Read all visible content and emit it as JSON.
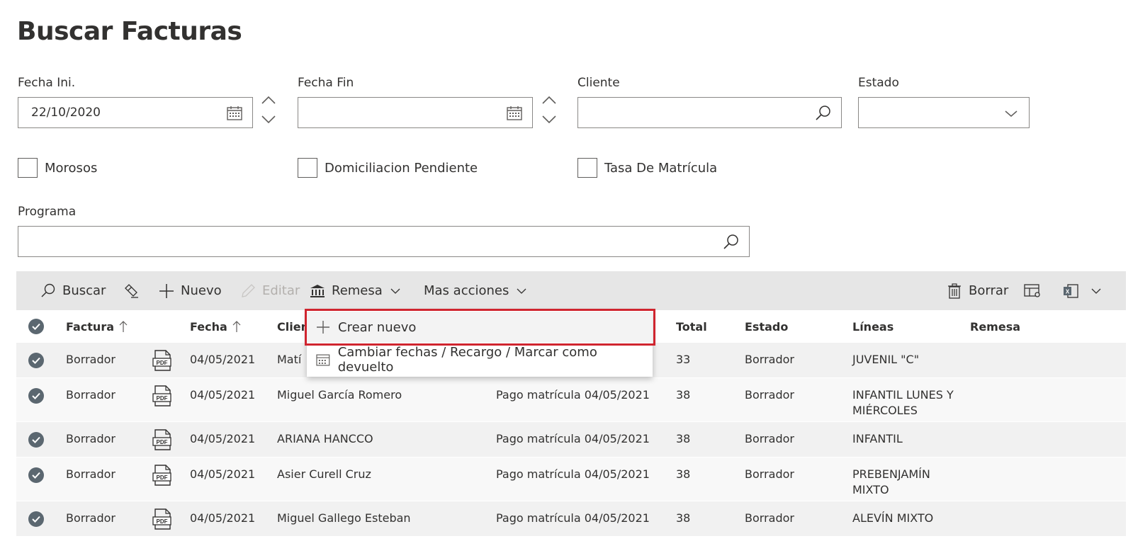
{
  "page": {
    "title": "Buscar Facturas"
  },
  "filters": {
    "fecha_ini": {
      "label": "Fecha Ini.",
      "value": "22/10/2020"
    },
    "fecha_fin": {
      "label": "Fecha Fin",
      "value": ""
    },
    "cliente": {
      "label": "Cliente",
      "value": ""
    },
    "estado": {
      "label": "Estado",
      "value": ""
    },
    "morosos": {
      "label": "Morosos"
    },
    "domiciliacion": {
      "label": "Domiciliacion Pendiente"
    },
    "tasa": {
      "label": "Tasa De Matrícula"
    },
    "programa": {
      "label": "Programa",
      "value": ""
    }
  },
  "toolbar": {
    "buscar": "Buscar",
    "nuevo": "Nuevo",
    "editar": "Editar",
    "remesa": "Remesa",
    "mas_acciones": "Mas acciones",
    "borrar": "Borrar"
  },
  "grid": {
    "columns": {
      "factura": "Factura",
      "fecha": "Fecha",
      "cliente": "Clien",
      "total": "Total",
      "estado": "Estado",
      "lineas": "Líneas",
      "remesa": "Remesa"
    },
    "rows": [
      {
        "factura": "Borrador",
        "fecha": "04/05/2021",
        "cliente": "Matí",
        "concepto": "",
        "total": "33",
        "estado": "Borrador",
        "lineas": "JUVENIL \"C\""
      },
      {
        "factura": "Borrador",
        "fecha": "04/05/2021",
        "cliente": "Miguel García Romero",
        "concepto": "Pago matrícula 04/05/2021",
        "total": "38",
        "estado": "Borrador",
        "lineas": "INFANTIL LUNES Y MIÉRCOLES"
      },
      {
        "factura": "Borrador",
        "fecha": "04/05/2021",
        "cliente": "ARIANA HANCCO",
        "concepto": "Pago matrícula 04/05/2021",
        "total": "38",
        "estado": "Borrador",
        "lineas": "INFANTIL"
      },
      {
        "factura": "Borrador",
        "fecha": "04/05/2021",
        "cliente": "Asier Curell Cruz",
        "concepto": "Pago matrícula 04/05/2021",
        "total": "38",
        "estado": "Borrador",
        "lineas": "PREBENJAMÍN MIXTO"
      },
      {
        "factura": "Borrador",
        "fecha": "04/05/2021",
        "cliente": "Miguel Gallego Esteban",
        "concepto": "Pago matrícula 04/05/2021",
        "total": "38",
        "estado": "Borrador",
        "lineas": "ALEVÍN MIXTO"
      }
    ]
  },
  "menu": {
    "crear_nuevo": "Crear nuevo",
    "cambiar_fechas": "Cambiar fechas / Recargo / Marcar como devuelto"
  },
  "icons": {
    "pdf": "PDF"
  }
}
